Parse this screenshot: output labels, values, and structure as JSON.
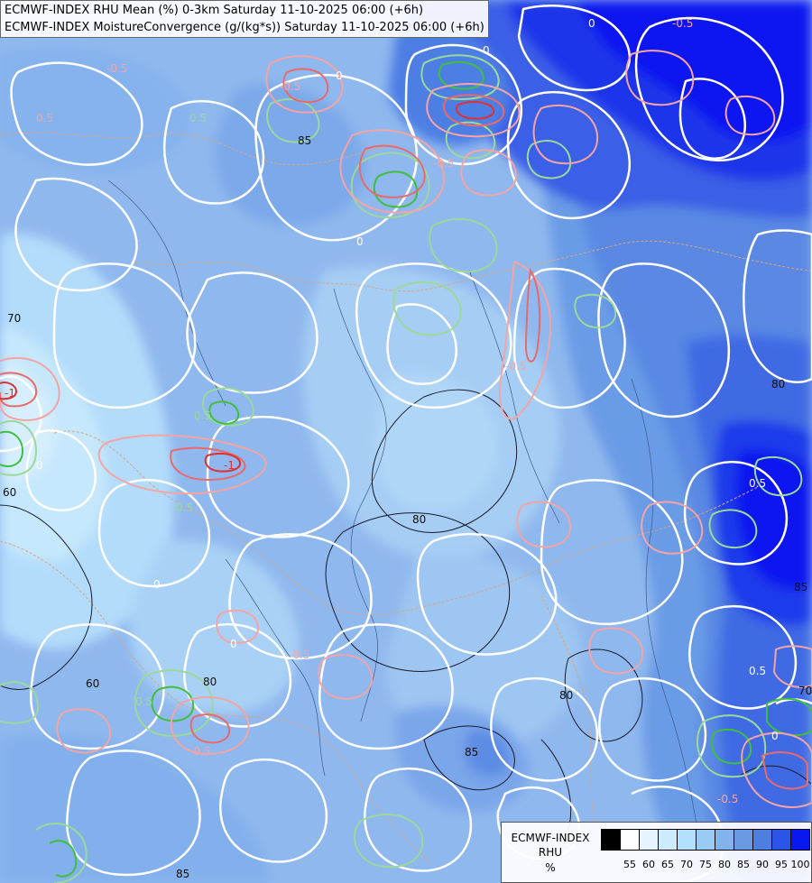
{
  "title": {
    "line1": "ECMWF-INDEX RHU Mean (%) 0-3km Saturday 11-10-2025 06:00 (+6h)",
    "line2": "ECMWF-INDEX MoistureConvergence (g/(kg*s)) Saturday 11-10-2025 06:00 (+6h)"
  },
  "legend": {
    "title_line1": "ECMWF-INDEX",
    "title_line2": "RHU",
    "unit": "%",
    "colors": [
      "#000000",
      "#ffffff",
      "#e6f4ff",
      "#ccebff",
      "#b3e0fd",
      "#99ccf5",
      "#82b3ec",
      "#6a9ae3",
      "#4d7ee0",
      "#2a55e6",
      "#0a18f0"
    ],
    "ticks": [
      "55",
      "60",
      "65",
      "70",
      "75",
      "80",
      "85",
      "90",
      "95",
      "100"
    ]
  },
  "contour_labels": {
    "rhu": [
      "80",
      "80",
      "85",
      "85",
      "80",
      "80",
      "60",
      "60",
      "85",
      "85",
      "70",
      "70"
    ],
    "conv": [
      "0",
      "0",
      "0",
      "0",
      "0",
      "0",
      "0",
      "0",
      "0.5",
      "0.5",
      "0.5",
      "0.5",
      "-0.5",
      "-0.5",
      "-0.5",
      "-0.5",
      "-0.5",
      "-0.5",
      "-0.5",
      "0.5",
      "0.5",
      "0.5",
      "-0.5",
      "-1",
      "-1"
    ]
  }
}
